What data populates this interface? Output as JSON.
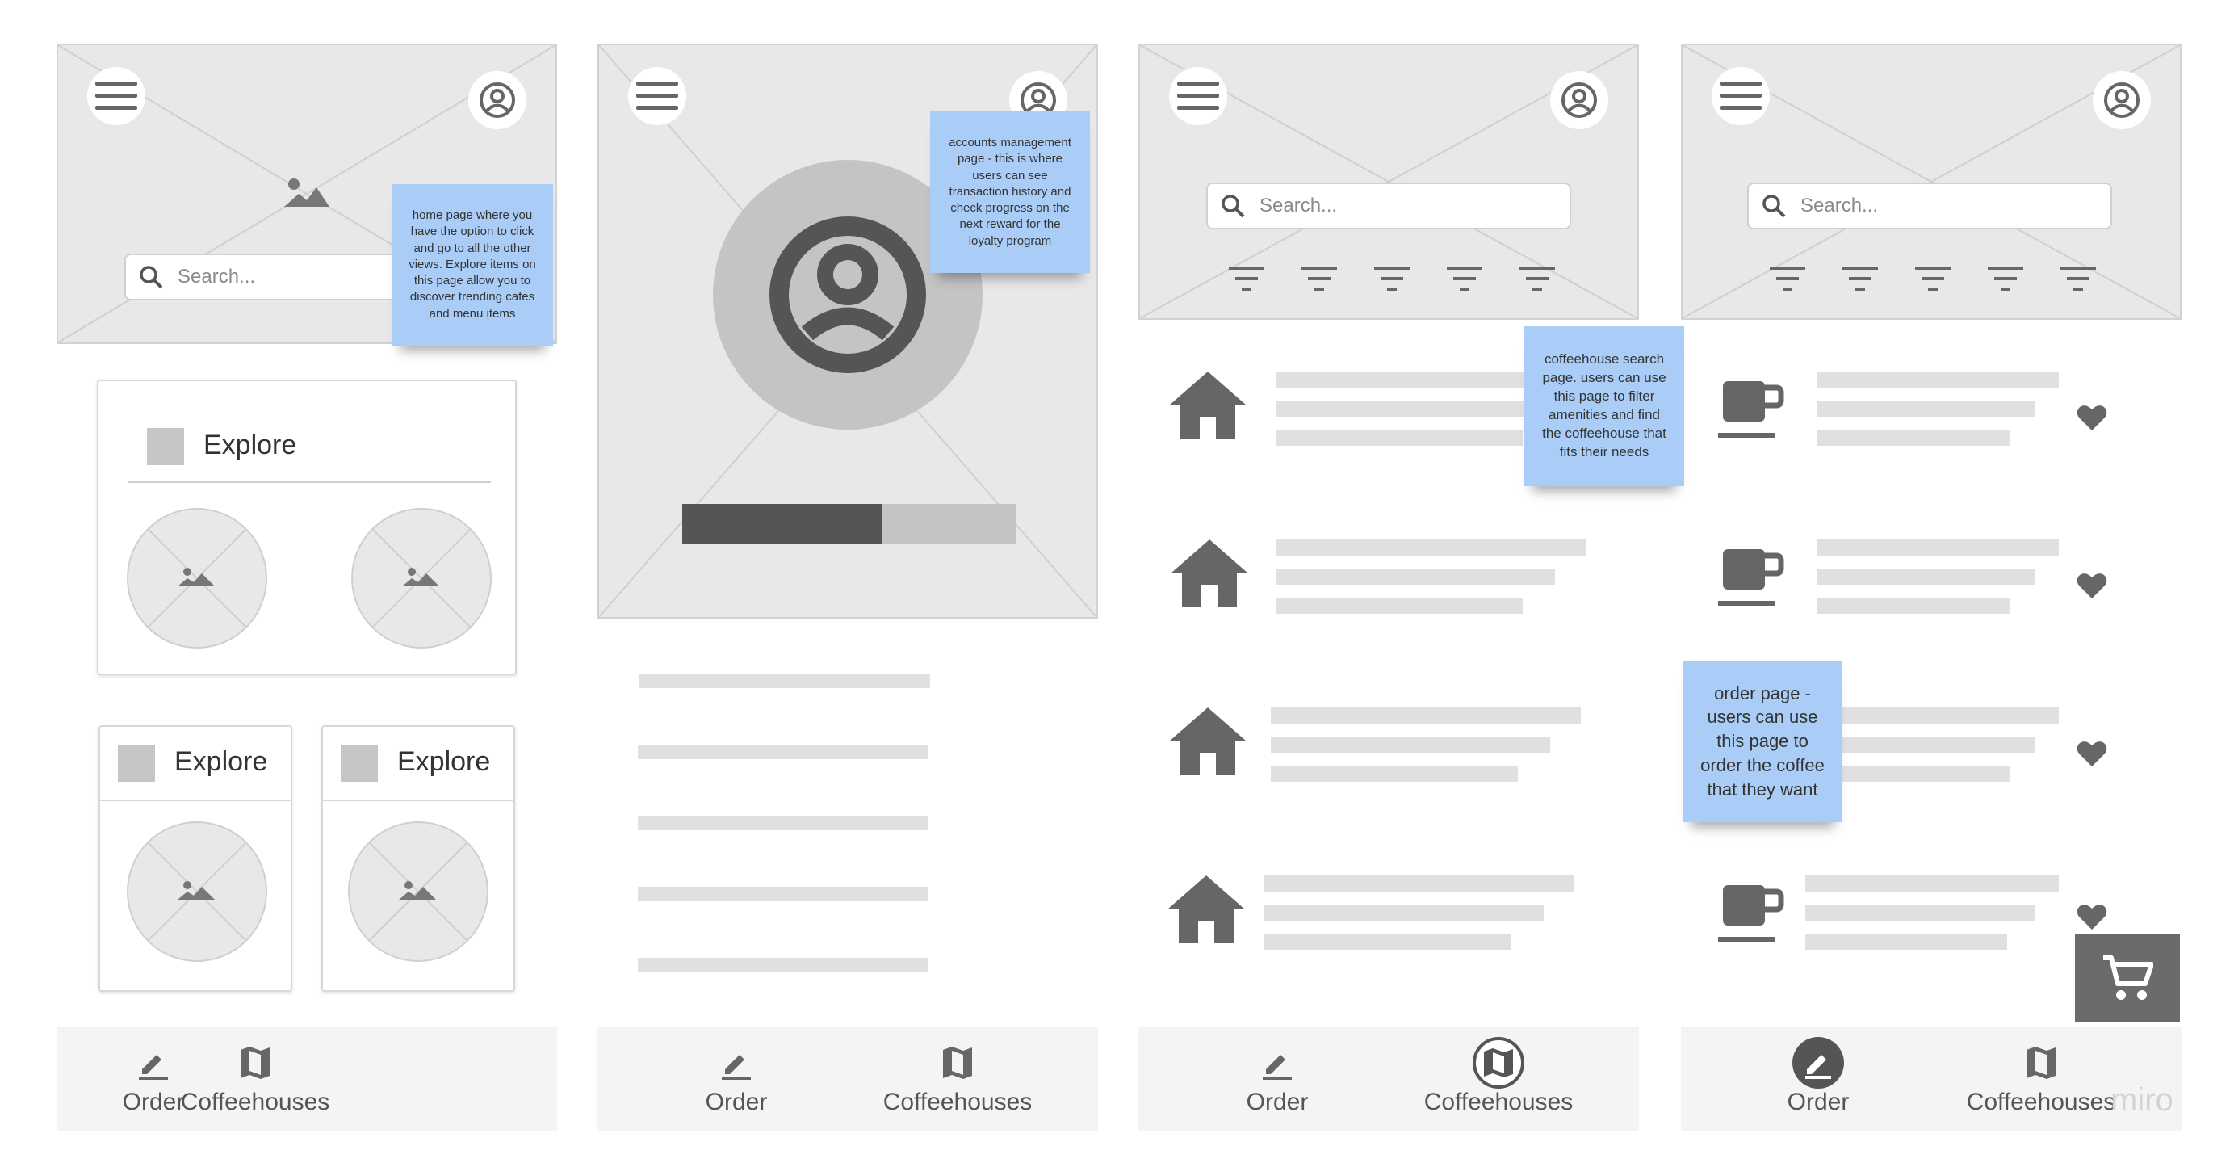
{
  "search": {
    "placeholder": "Search..."
  },
  "explore": {
    "label": "Explore"
  },
  "notes": {
    "home": "home page where you have the option to click and go to all the other views.  Explore items on this page allow you to discover trending cafes and menu items",
    "account": "accounts management page - this is where users can see transaction history and check progress on the next reward for the loyalty program",
    "search_page": "coffeehouse search page.  users can use this page to filter amenities and find the coffeehouse that fits their needs",
    "order": "order page - users can use this page to order the coffee that they want"
  },
  "loyalty_progress": 0.6,
  "nav": {
    "order": "Order",
    "coffeehouses": "Coffeehouses"
  },
  "watermark": "miro",
  "colors": {
    "sticky": "#a9cdf7",
    "wireframe_fill": "#e8e8e8",
    "icon": "#6b6b6b"
  }
}
